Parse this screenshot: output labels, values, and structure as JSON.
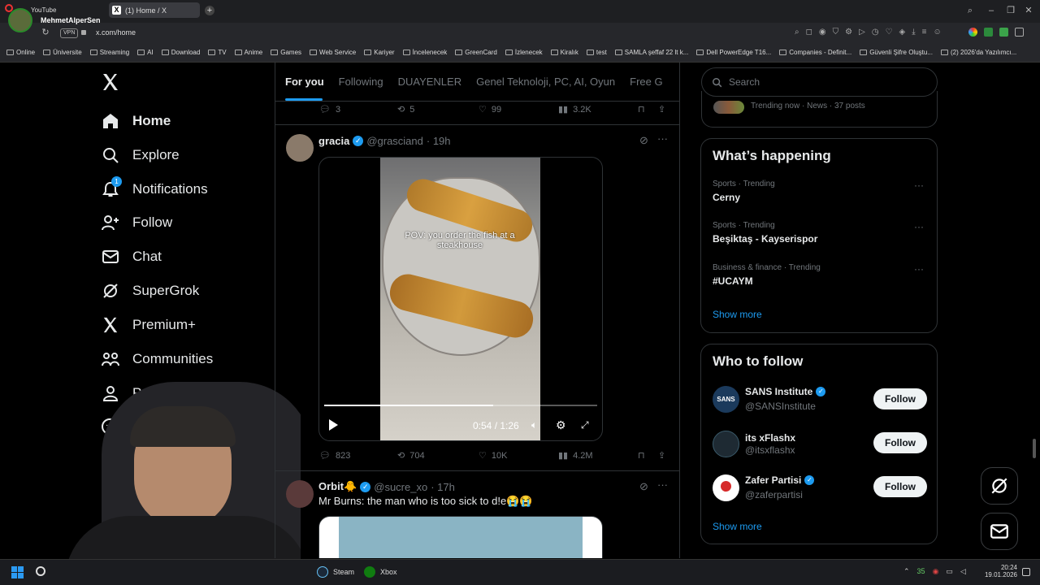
{
  "browser": {
    "profile_label": "YouTube",
    "profile_name": "MehmetAlperSen",
    "tab_title": "(1) Home / X",
    "vpn_label": "VPN",
    "url": "x.com/home"
  },
  "bookmarks": [
    "Online",
    "Üniversite",
    "Streaming",
    "AI",
    "Download",
    "TV",
    "Anime",
    "Games",
    "Web Service",
    "Kariyer",
    "İncelenecek",
    "GreenCard",
    "İzlenecek",
    "Kiralık",
    "test",
    "SAMLA şeffaf 22 lt k...",
    "Dell PowerEdge T16...",
    "Companies - Definit...",
    "Güvenli Şifre Oluştu...",
    "(2) 2026'da Yazılımcı..."
  ],
  "nav": {
    "home": "Home",
    "explore": "Explore",
    "notifications": "Notifications",
    "notif_badge": "1",
    "follow": "Follow",
    "chat": "Chat",
    "supergrok": "SuperGrok",
    "premium": "Premium+",
    "communities": "Communities",
    "profile": "Pro"
  },
  "feed": {
    "tabs": [
      "For you",
      "Following",
      "DUAYENLER",
      "Genel Teknoloji, PC, AI, Oyun",
      "Free G"
    ],
    "prev_post": {
      "replies": "3",
      "reposts": "5",
      "likes": "99",
      "views": "3.2K"
    },
    "post1": {
      "name": "gracia",
      "handle": "@grasciand",
      "time": "· 19h",
      "video_caption": "POV: you order the fish at a steakhouse",
      "video_time": "0:54 / 1:26",
      "video_progress": 0.62,
      "replies": "823",
      "reposts": "704",
      "likes": "10K",
      "views": "4.2M"
    },
    "post2": {
      "name": "Orbit🐥",
      "handle": "@sucre_xo",
      "time": "· 17h",
      "text": "Mr Burns: the man who is too sick to d!e😭😭"
    }
  },
  "sidebar": {
    "search_placeholder": "Search",
    "trending_now": "Trending now · News · 37 posts",
    "whats_happening": "What’s happening",
    "trends": [
      {
        "category": "Sports · Trending",
        "title": "Cerny"
      },
      {
        "category": "Sports · Trending",
        "title": "Beşiktaş - Kayserispor"
      },
      {
        "category": "Business & finance · Trending",
        "title": "#UCAYM"
      }
    ],
    "show_more": "Show more",
    "who_to_follow": "Who to follow",
    "suggestions": [
      {
        "name": "SANS Institute",
        "handle": "@SANSInstitute",
        "button": "Follow",
        "avatar": "SANS"
      },
      {
        "name": "its xFlashx",
        "handle": "@itsxflashx",
        "button": "Follow",
        "avatar": ""
      },
      {
        "name": "Zafer Partisi",
        "handle": "@zaferpartisi",
        "button": "Follow",
        "avatar": ""
      }
    ],
    "show_more_2": "Show more"
  },
  "taskbar": {
    "steam": "Steam",
    "xbox": "Xbox",
    "time": "20:24",
    "date": "19.01.2026",
    "tray_num": "35"
  },
  "colors": {
    "accent": "#1d9bf0",
    "background": "#000000",
    "border": "#2f3336"
  }
}
